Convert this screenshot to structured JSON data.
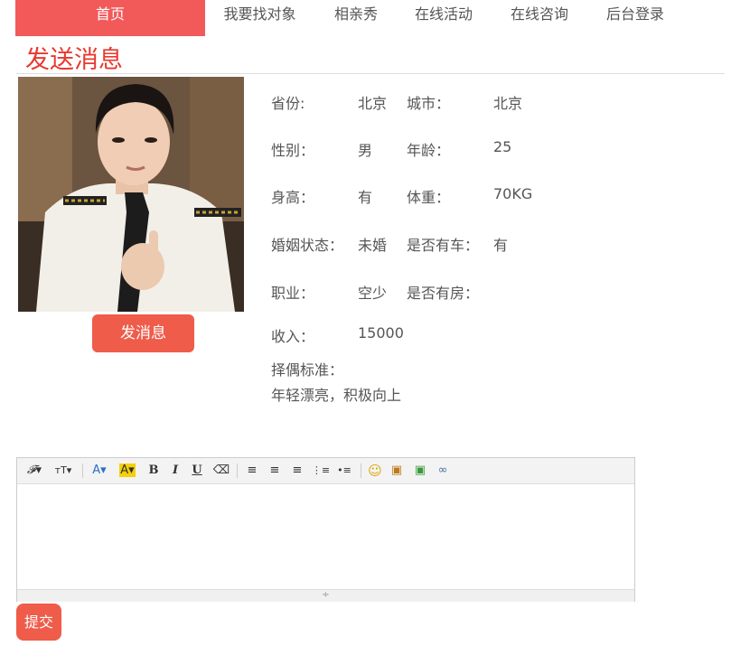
{
  "nav": {
    "items": [
      {
        "label": "首页"
      },
      {
        "label": "我要找对象"
      },
      {
        "label": "相亲秀"
      },
      {
        "label": "在线活动"
      },
      {
        "label": "在线咨询"
      },
      {
        "label": "后台登录"
      }
    ]
  },
  "page_title": "发送消息",
  "profile": {
    "send_message_label": "发消息",
    "fields": {
      "province_label": "省份:",
      "province_value": "北京",
      "city_label": "城市：",
      "city_value": "北京",
      "gender_label": "性别：",
      "gender_value": "男",
      "age_label": "年龄：",
      "age_value": "25",
      "height_label": "身高：",
      "height_value": "有",
      "weight_label": "体重：",
      "weight_value": "70KG",
      "marital_label": "婚姻状态：",
      "marital_value": "未婚",
      "car_label": "是否有车：",
      "car_value": "有",
      "job_label": "职业：",
      "job_value": "空少",
      "house_label": "是否有房：",
      "house_value": "",
      "income_label": "收入：",
      "income_value": "15000",
      "criteria_label": "择偶标准：",
      "criteria_value": "年轻漂亮，积极向上"
    }
  },
  "editor": {
    "toolbar": [
      {
        "icon": "font-family-icon",
        "glyph": "𝓕▾"
      },
      {
        "icon": "font-size-icon",
        "glyph": "ᴛT▾"
      },
      {
        "icon": "font-color-icon",
        "glyph": "A▾"
      },
      {
        "icon": "highlight-icon",
        "glyph": "A▾"
      },
      {
        "icon": "bold-icon",
        "glyph": "B"
      },
      {
        "icon": "italic-icon",
        "glyph": "I"
      },
      {
        "icon": "underline-icon",
        "glyph": "U"
      },
      {
        "icon": "eraser-icon",
        "glyph": "⌫"
      },
      {
        "icon": "align-left-icon",
        "glyph": "≡"
      },
      {
        "icon": "align-center-icon",
        "glyph": "≡"
      },
      {
        "icon": "align-right-icon",
        "glyph": "≡"
      },
      {
        "icon": "ordered-list-icon",
        "glyph": "⋮≡"
      },
      {
        "icon": "unordered-list-icon",
        "glyph": "•≡"
      },
      {
        "icon": "emoji-icon",
        "glyph": "☺"
      },
      {
        "icon": "image-icon",
        "glyph": "▣"
      },
      {
        "icon": "multi-image-icon",
        "glyph": "▣"
      },
      {
        "icon": "link-icon",
        "glyph": "∞"
      }
    ],
    "resize_glyph": "÷"
  },
  "submit_label": "提交",
  "colors": {
    "accent": "#f25a5a",
    "button": "#ef5c4a",
    "title": "#e8382f"
  }
}
